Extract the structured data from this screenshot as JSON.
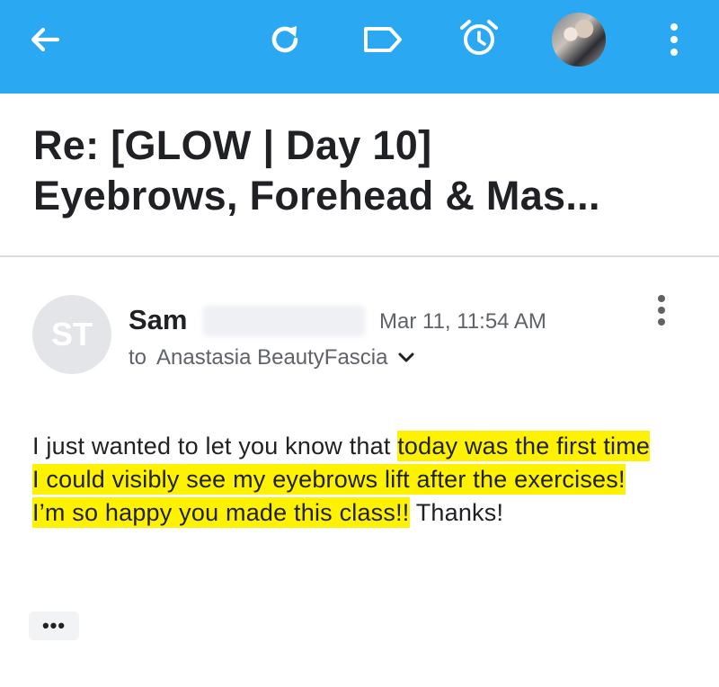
{
  "toolbar": {
    "back_icon": "arrow-back-icon",
    "refresh_icon": "refresh-icon",
    "label_icon": "label-icon",
    "snooze_icon": "alarm-clock-icon",
    "menu_icon": "more-vert-icon",
    "accent_color": "#2aa9f2"
  },
  "email": {
    "subject_line1": "Re: [GLOW | Day 10]",
    "subject_line2": "Eyebrows, Forehead & Mas...",
    "sender_initials": "ST",
    "sender_first_name": "Sam",
    "date": "Mar 11, 11:54 AM",
    "to_label": "to",
    "recipient": "Anastasia BeautyFascia",
    "body_plain_1": "I just wanted to let you know that ",
    "body_highlight": "today was the first time I could visibly see my eyebrows lift after the exercises! I’m so happy you made this class!!",
    "body_plain_2": " Thanks!",
    "trimmed_content_label": "•••",
    "highlight_color": "#fff200"
  }
}
